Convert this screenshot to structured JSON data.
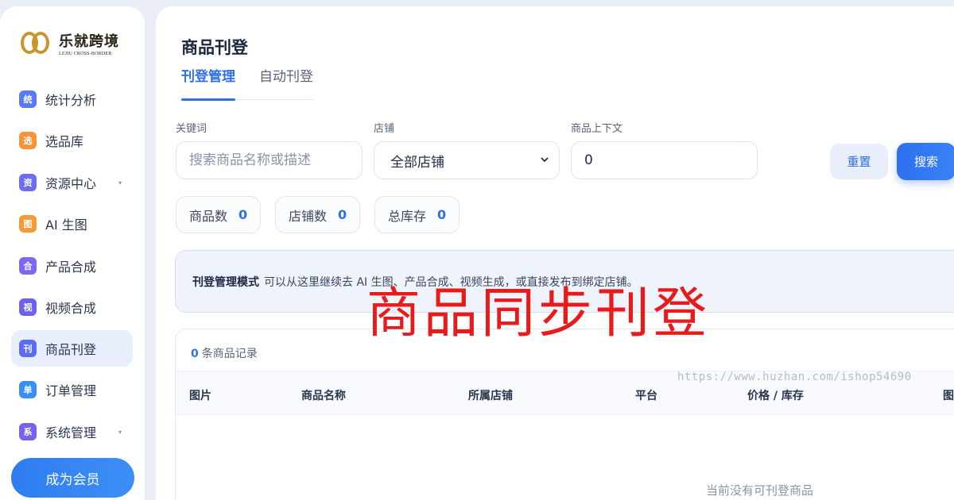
{
  "brand": {
    "name_cn": "乐就跨境",
    "name_en": "LEJIU CROSS-BORDER",
    "logo_color": "#c9962e"
  },
  "sidebar": {
    "items": [
      {
        "icon_char": "统",
        "label": "统计分析",
        "color": "#5a7bf0",
        "caret": ""
      },
      {
        "icon_char": "选",
        "label": "选品库",
        "color": "#f7943b",
        "caret": ""
      },
      {
        "icon_char": "资",
        "label": "资源中心",
        "color": "#6b6ef2",
        "caret": "▾"
      },
      {
        "icon_char": "图",
        "label": "AI 生图",
        "color": "#f39b36",
        "caret": ""
      },
      {
        "icon_char": "合",
        "label": "产品合成",
        "color": "#7a6af0",
        "caret": ""
      },
      {
        "icon_char": "视",
        "label": "视频合成",
        "color": "#6b63ea",
        "caret": ""
      },
      {
        "icon_char": "刊",
        "label": "商品刊登",
        "color": "#5b6cf0",
        "caret": "",
        "active": true
      },
      {
        "icon_char": "单",
        "label": "订单管理",
        "color": "#3b8ff0",
        "caret": ""
      },
      {
        "icon_char": "系",
        "label": "系统管理",
        "color": "#7563ee",
        "caret": "▾"
      }
    ],
    "vip_button": "成为会员"
  },
  "page": {
    "title": "商品刊登",
    "tabs": [
      {
        "label": "刊登管理",
        "active": true
      },
      {
        "label": "自动刊登",
        "active": false
      }
    ]
  },
  "filters": {
    "keyword": {
      "label": "关键词",
      "placeholder": "搜索商品名称或描述",
      "value": ""
    },
    "store": {
      "label": "店铺",
      "selected": "全部店铺"
    },
    "context": {
      "label": "商品上下文",
      "value": "0"
    },
    "reset_label": "重置",
    "search_label": "搜索"
  },
  "stats": [
    {
      "label": "商品数",
      "value": "0"
    },
    {
      "label": "店铺数",
      "value": "0"
    },
    {
      "label": "总库存",
      "value": "0"
    }
  ],
  "notice": {
    "title": "刊登管理模式",
    "text": "可以从这里继续去 AI 生图、产品合成、视频生成，或直接发布到绑定店铺。"
  },
  "table": {
    "record_count": "0",
    "record_suffix": "条商品记录",
    "headers": [
      "图片",
      "商品名称",
      "所属店铺",
      "平台",
      "价格 / 库存",
      "图"
    ],
    "empty_text": "当前没有可刊登商品"
  },
  "overlay": {
    "title": "商品同步刊登",
    "watermark": "https://www.huzhan.com/ishop54690"
  },
  "colors": {
    "accent": "#2f6fe8",
    "overlay_red": "#e81a1a"
  }
}
